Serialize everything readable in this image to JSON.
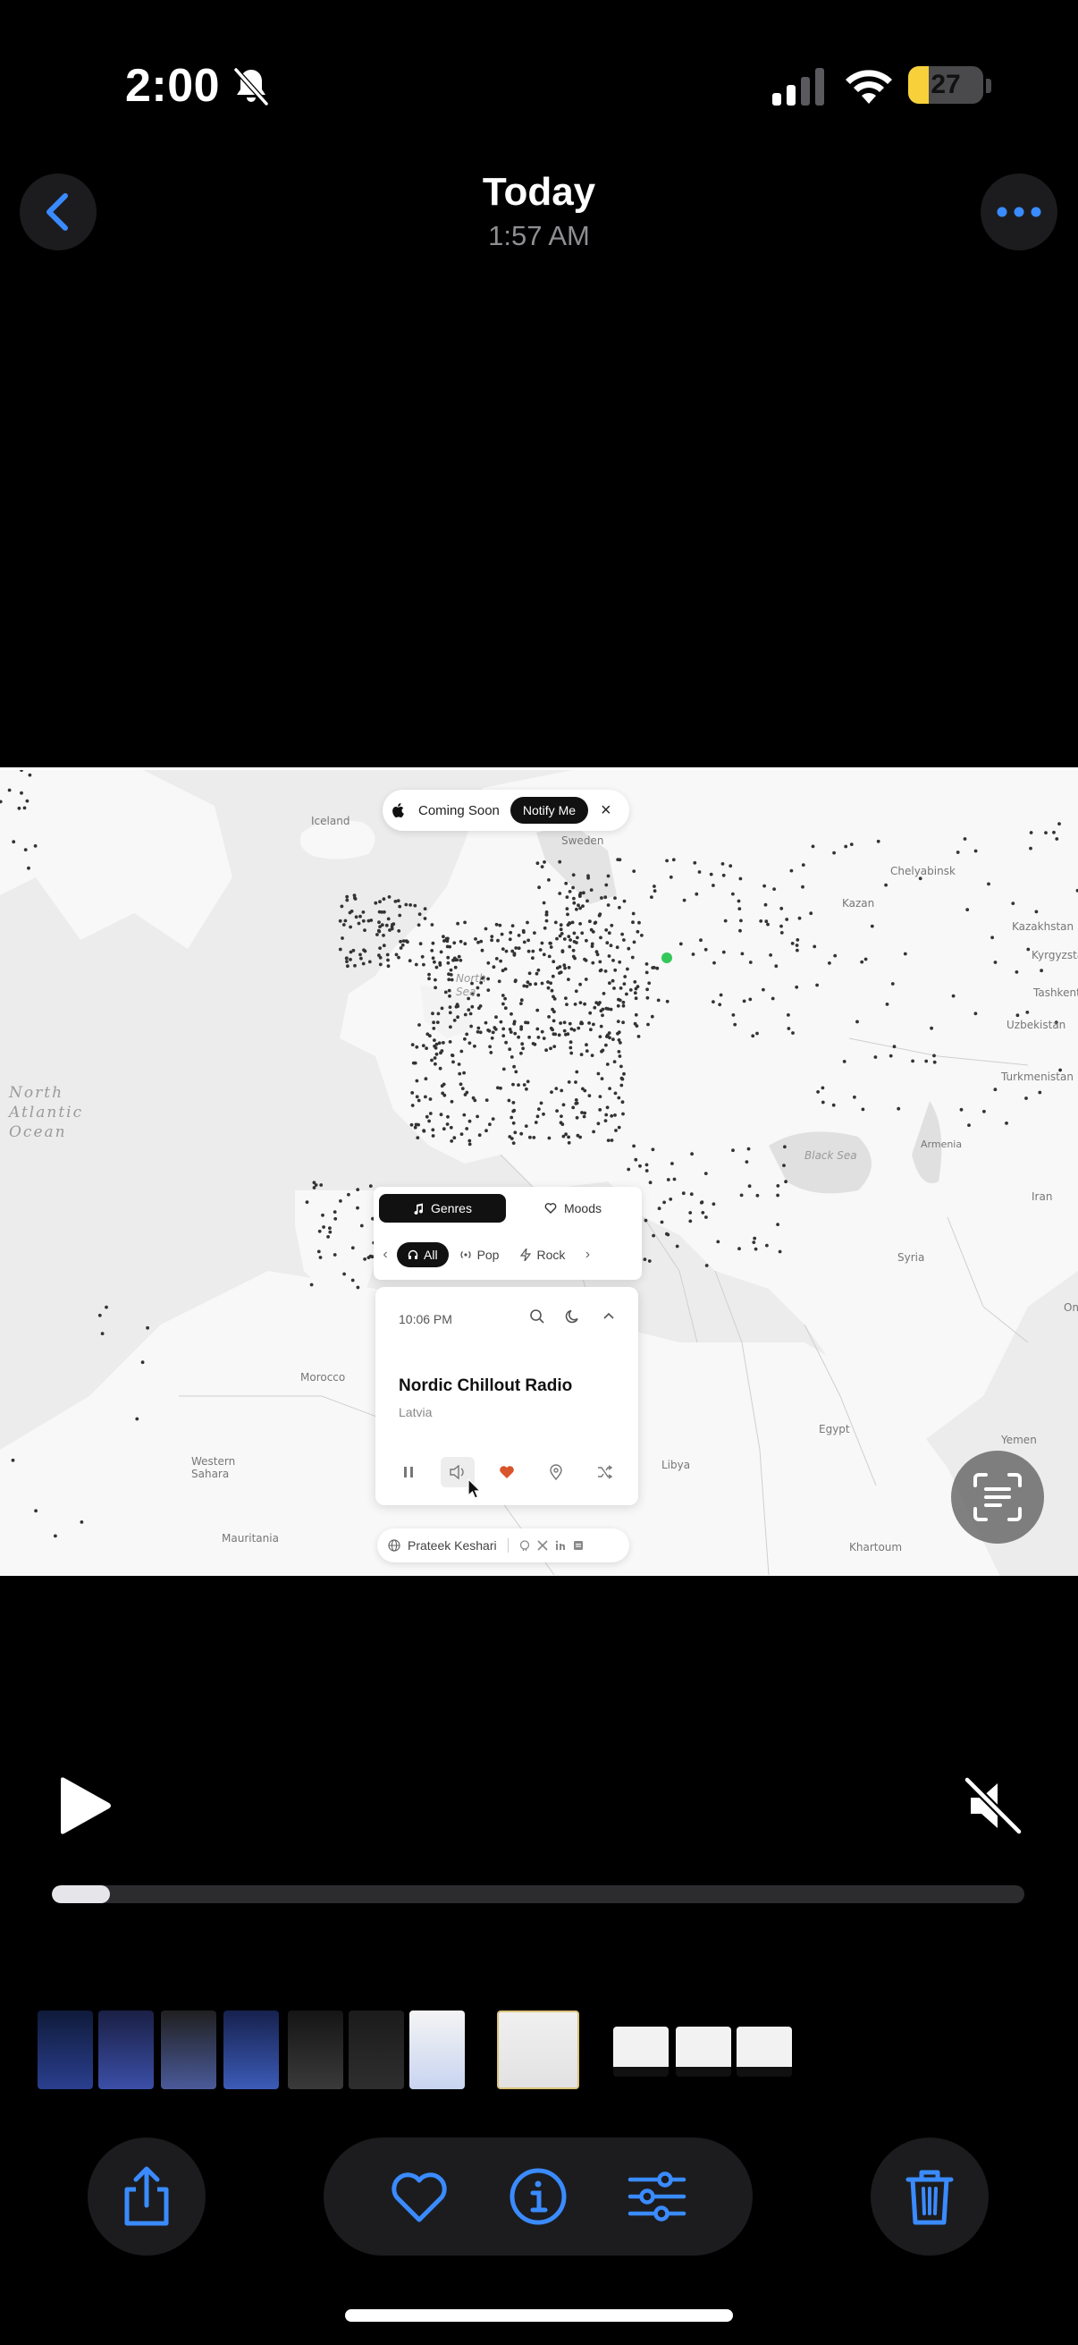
{
  "status_bar": {
    "time": "2:00",
    "battery_level": "27",
    "battery_fraction": 0.27
  },
  "header": {
    "title": "Today",
    "subtitle": "1:57 AM",
    "back_icon": "chevron-left-icon",
    "more_icon": "ellipsis-icon"
  },
  "video": {
    "map_labels": {
      "iceland": "Iceland",
      "sweden": "Sweden",
      "north_sea": "North Sea",
      "ocean": "North Atlantic Ocean",
      "kazan": "Kazan",
      "chelyabinsk": "Chelyabinsk",
      "kazakhstan": "Kazakhstan",
      "kyrgyzstan": "Kyrgyzsta",
      "tashkent": "Tashkent",
      "uzbekistan": "Uzbekistan",
      "turkmenistan": "Turkmenistan",
      "iran": "Iran",
      "black_sea": "Black Sea",
      "armenia": "Armenia",
      "syria": "Syria",
      "egypt": "Egypt",
      "libya": "Libya",
      "morocco": "Morocco",
      "western_sahara": "Western Sahara",
      "mauritania": "Mauritania",
      "yemen": "Yemen",
      "khartoum": "Khartoum",
      "om": "Om"
    },
    "banner": {
      "label": "Coming Soon",
      "button": "Notify Me",
      "close": "×"
    },
    "tabs": {
      "genres": "Genres",
      "moods": "Moods"
    },
    "chips": [
      "All",
      "Pop",
      "Rock"
    ],
    "player": {
      "time": "10:06 PM",
      "station": "Nordic Chillout Radio",
      "country": "Latvia"
    },
    "credit": {
      "name": "Prateek Keshari"
    }
  },
  "playback": {
    "progress": 0.06
  },
  "toolbar": {
    "share": "share-icon",
    "favorite": "heart-icon",
    "info": "info-icon",
    "adjust": "sliders-icon",
    "delete": "trash-icon"
  },
  "colors": {
    "accent": "#3a8bff",
    "background": "#000000",
    "battery": "#f7d13a",
    "heart": "#d9542b"
  }
}
